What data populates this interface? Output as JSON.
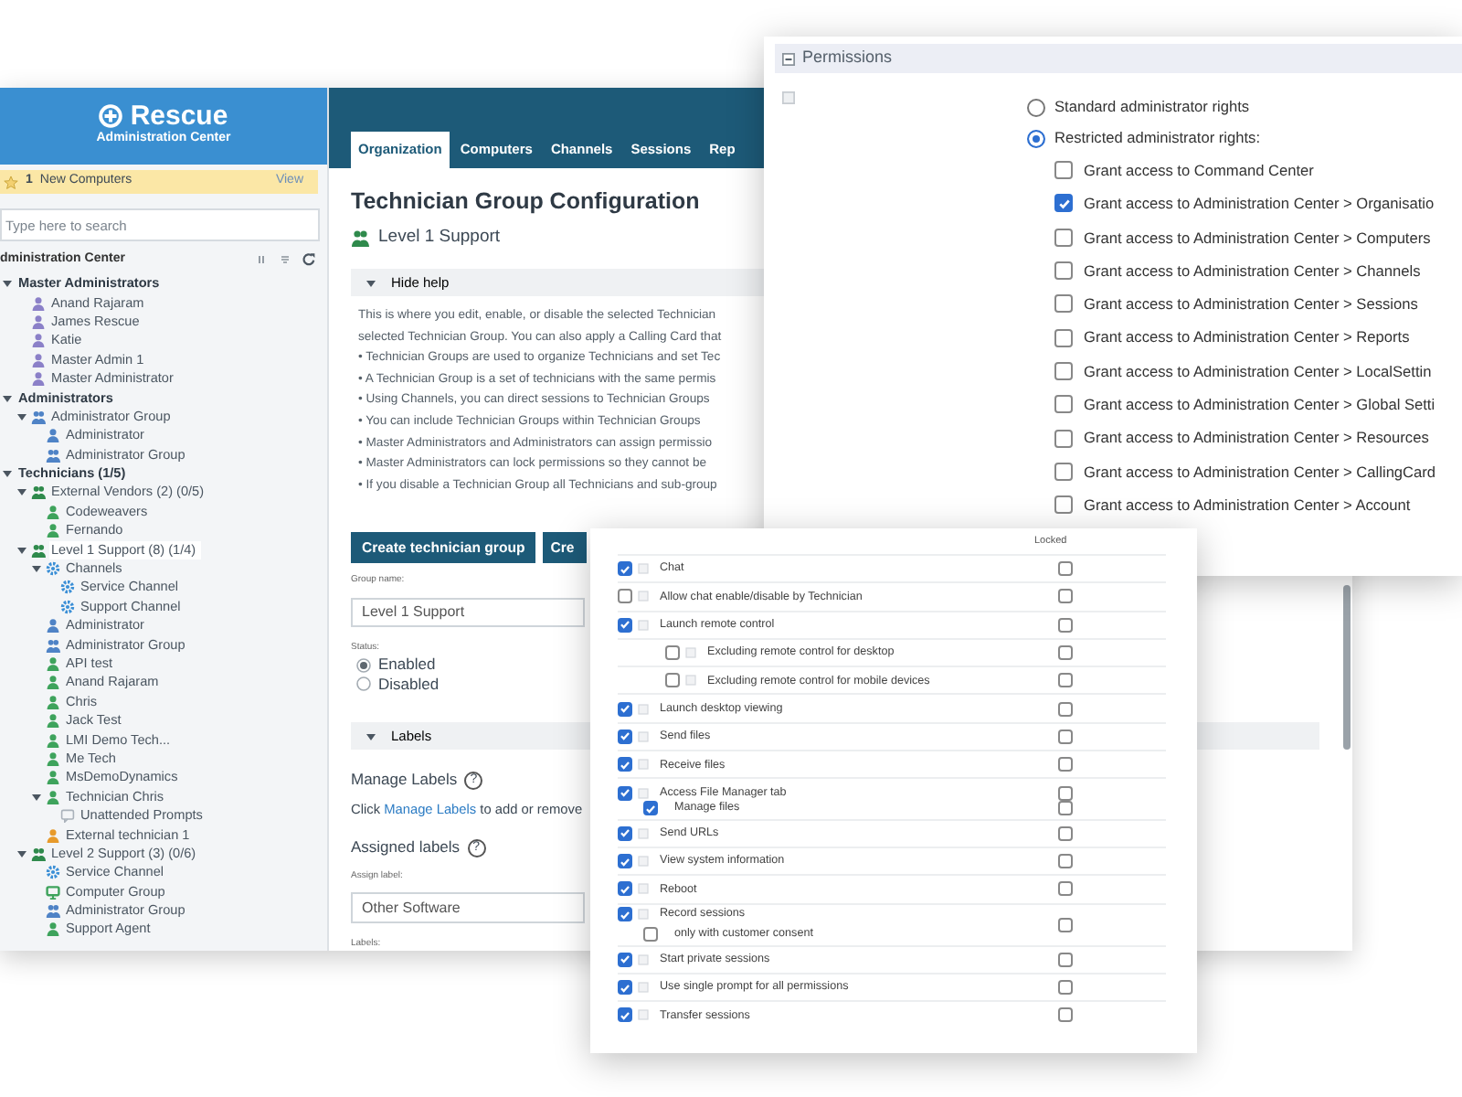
{
  "admin_window": {
    "sidebar": {
      "brand": {
        "name": "Rescue",
        "subtitle": "Administration Center"
      },
      "notice": {
        "count": "1",
        "text": "New Computers",
        "action": "View"
      },
      "search": {
        "placeholder": "Type here to search"
      },
      "tree_title": "dministration Center",
      "tree": [
        {
          "label": "Master Administrators",
          "kind": "category",
          "expanded": true,
          "selected": false,
          "children": [
            {
              "label": "Anand Rajaram",
              "kind": "master",
              "selected": false
            },
            {
              "label": "James Rescue",
              "kind": "master",
              "selected": false
            },
            {
              "label": "Katie",
              "kind": "master",
              "selected": false
            },
            {
              "label": "Master Admin 1",
              "kind": "master",
              "selected": false
            },
            {
              "label": "Master Administrator",
              "kind": "master",
              "selected": false
            }
          ]
        },
        {
          "label": "Administrators",
          "kind": "category",
          "expanded": true,
          "selected": false,
          "children": [
            {
              "label": "Administrator Group",
              "kind": "admin-group",
              "expanded": true,
              "selected": false,
              "children": [
                {
                  "label": "Administrator",
                  "kind": "admin",
                  "selected": false
                },
                {
                  "label": "Administrator Group",
                  "kind": "admin-group",
                  "selected": false
                }
              ]
            }
          ]
        },
        {
          "label": "Technicians (1/5)",
          "kind": "category",
          "expanded": true,
          "selected": false,
          "children": [
            {
              "label": "External Vendors (2) (0/5)",
              "kind": "tech-group",
              "expanded": true,
              "selected": false,
              "children": [
                {
                  "label": "Codeweavers",
                  "kind": "technician",
                  "selected": false
                },
                {
                  "label": "Fernando",
                  "kind": "technician",
                  "selected": false
                }
              ]
            },
            {
              "label": "Level 1 Support (8) (1/4)",
              "kind": "tech-group",
              "expanded": true,
              "selected": true,
              "children": [
                {
                  "label": "Channels",
                  "kind": "channel",
                  "expanded": true,
                  "selected": false,
                  "children": [
                    {
                      "label": "Service Channel",
                      "kind": "channel",
                      "selected": false
                    },
                    {
                      "label": "Support Channel",
                      "kind": "channel",
                      "selected": false
                    }
                  ]
                },
                {
                  "label": "Administrator",
                  "kind": "admin",
                  "selected": false
                },
                {
                  "label": "Administrator Group",
                  "kind": "admin-group",
                  "selected": false
                },
                {
                  "label": "API test",
                  "kind": "technician",
                  "selected": false
                },
                {
                  "label": "Anand Rajaram",
                  "kind": "technician",
                  "selected": false
                },
                {
                  "label": "Chris",
                  "kind": "technician",
                  "selected": false
                },
                {
                  "label": "Jack Test",
                  "kind": "technician",
                  "selected": false
                },
                {
                  "label": "LMI Demo Tech...",
                  "kind": "technician",
                  "selected": false
                },
                {
                  "label": "Me Tech",
                  "kind": "technician",
                  "selected": false
                },
                {
                  "label": "MsDemoDynamics",
                  "kind": "technician",
                  "selected": false
                },
                {
                  "label": "Technician Chris",
                  "kind": "technician",
                  "expanded": true,
                  "selected": false,
                  "children": [
                    {
                      "label": "Unattended Prompts",
                      "kind": "prompt",
                      "selected": false
                    }
                  ]
                },
                {
                  "label": "External technician 1",
                  "kind": "external",
                  "selected": false
                }
              ]
            },
            {
              "label": "Level 2 Support (3) (0/6)",
              "kind": "tech-group",
              "expanded": true,
              "selected": false,
              "children": [
                {
                  "label": "Service Channel",
                  "kind": "channel",
                  "selected": false
                },
                {
                  "label": "Computer Group",
                  "kind": "computer-group",
                  "selected": false
                },
                {
                  "label": "Administrator Group",
                  "kind": "admin-group",
                  "selected": false
                },
                {
                  "label": "Support Agent",
                  "kind": "technician",
                  "selected": false
                }
              ]
            }
          ]
        }
      ]
    },
    "tabs": [
      {
        "label": "Organization",
        "selected": true
      },
      {
        "label": "Computers",
        "selected": false
      },
      {
        "label": "Channels",
        "selected": false
      },
      {
        "label": "Sessions",
        "selected": false
      },
      {
        "label": "Rep",
        "selected": false
      }
    ],
    "page_title": "Technician Group Configuration",
    "group_heading": "Level 1 Support",
    "help_toggle": {
      "label": "Hide help",
      "expanded": true
    },
    "help_lines": [
      "This is where you edit, enable, or disable the selected Technician",
      "selected Technician Group. You can also apply a Calling Card that",
      "• Technician Groups are used to organize Technicians and set Tec",
      "• A Technician Group is a set of technicians with the same permis",
      "• Using Channels, you can direct sessions to Technician Groups",
      "• You can include Technician Groups within Technician Groups",
      "• Master Administrators and Administrators can assign permissio",
      "• Master Administrators can lock permissions so they cannot be",
      "• If you disable a Technician Group all Technicians and sub-group"
    ],
    "buttons": [
      "Create technician group",
      "Cre"
    ],
    "form": {
      "group_name": {
        "label": "Group name:",
        "value": "Level 1 Support"
      },
      "status": {
        "label": "Status:",
        "options": [
          {
            "label": "Enabled",
            "selected": true
          },
          {
            "label": "Disabled",
            "selected": false
          }
        ]
      }
    },
    "labels_section": {
      "toggle": {
        "label": "Labels",
        "expanded": true
      },
      "manage": {
        "title": "Manage Labels",
        "help": "?",
        "before": "Click",
        "link": "Manage Labels",
        "after": "to add or remove"
      },
      "assigned": {
        "title": "Assigned labels",
        "help": "?",
        "assign_label": "Assign label:",
        "assign_value": "Other Software",
        "labels_label": "Labels:"
      }
    }
  },
  "permissions_window": {
    "title": "Permissions",
    "expanded": true,
    "rights": [
      {
        "label": "Standard administrator rights",
        "selected": false
      },
      {
        "label": "Restricted administrator rights:",
        "selected": true
      }
    ],
    "grants": [
      {
        "label": "Grant access to Command Center",
        "checked": false
      },
      {
        "label": "Grant access to Administration Center > Organisatio",
        "checked": true
      },
      {
        "label": "Grant access to Administration Center > Computers",
        "checked": false
      },
      {
        "label": "Grant access to Administration Center > Channels",
        "checked": false
      },
      {
        "label": "Grant access to Administration Center > Sessions",
        "checked": false
      },
      {
        "label": "Grant access to Administration Center > Reports",
        "checked": false
      },
      {
        "label": "Grant access to Administration Center > LocalSettin",
        "checked": false
      },
      {
        "label": "Grant access to Administration Center > Global Setti",
        "checked": false
      },
      {
        "label": "Grant access to Administration Center > Resources",
        "checked": false
      },
      {
        "label": "Grant access to Administration Center > CallingCard",
        "checked": false
      },
      {
        "label": "Grant access to Administration Center > Account",
        "checked": false
      }
    ]
  },
  "technician_permissions": {
    "locked_heading": "Locked",
    "rows": [
      {
        "kind": "main",
        "label": "Chat",
        "checked": true,
        "locked": false
      },
      {
        "kind": "main",
        "label": "Allow chat enable/disable by Technician",
        "checked": false,
        "locked": false
      },
      {
        "kind": "main",
        "label": "Launch remote control",
        "checked": true,
        "locked": false
      },
      {
        "kind": "sub",
        "label": "Excluding remote control for desktop",
        "checked": false,
        "locked": false
      },
      {
        "kind": "sub",
        "label": "Excluding remote control for mobile devices",
        "checked": false,
        "locked": false
      },
      {
        "kind": "main",
        "label": "Launch desktop viewing",
        "checked": true,
        "locked": false
      },
      {
        "kind": "main",
        "label": "Send files",
        "checked": true,
        "locked": false
      },
      {
        "kind": "main",
        "label": "Receive files",
        "checked": true,
        "locked": false
      },
      {
        "kind": "main",
        "label": "Access File Manager tab",
        "checked": true,
        "locked": false
      },
      {
        "kind": "option",
        "label": "Manage files",
        "checked": true,
        "locked": false
      },
      {
        "kind": "main",
        "label": "Send URLs",
        "checked": true,
        "locked": false
      },
      {
        "kind": "main",
        "label": "View system information",
        "checked": true,
        "locked": false
      },
      {
        "kind": "main",
        "label": "Reboot",
        "checked": true,
        "locked": false
      },
      {
        "kind": "main",
        "label": "Record sessions",
        "checked": true,
        "locked": false,
        "suboption": {
          "label": "only with customer consent",
          "checked": false
        }
      },
      {
        "kind": "main",
        "label": "Start private sessions",
        "checked": true,
        "locked": false
      },
      {
        "kind": "main",
        "label": "Use single prompt for all permissions",
        "checked": true,
        "locked": false
      },
      {
        "kind": "main",
        "label": "Transfer sessions",
        "checked": true,
        "locked": false
      }
    ]
  }
}
